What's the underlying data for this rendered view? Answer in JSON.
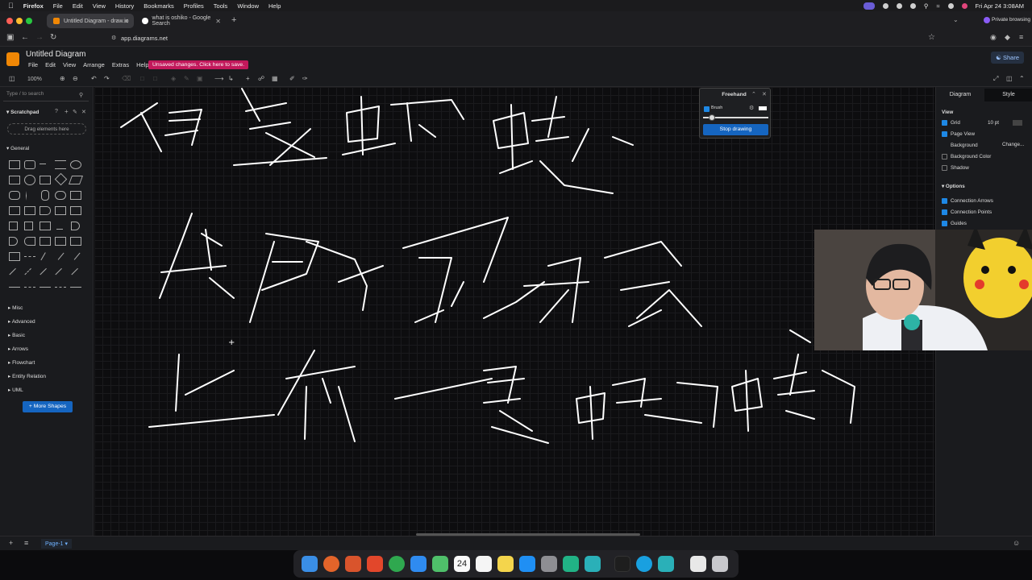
{
  "menubar": {
    "app": "Firefox",
    "items": [
      "File",
      "Edit",
      "View",
      "History",
      "Bookmarks",
      "Profiles",
      "Tools",
      "Window",
      "Help"
    ],
    "datetime": "Fri Apr 24  3:08AM",
    "status_icons": [
      "screen-record-icon",
      "play-icon",
      "moon-icon",
      "brightness-icon",
      "search-icon",
      "wifi-icon",
      "control-center-icon",
      "user-icon"
    ]
  },
  "browser": {
    "tabs": [
      {
        "title": "Untitled Diagram - draw.io",
        "active": true
      },
      {
        "title": "what is oshiko - Google Search",
        "active": false
      }
    ],
    "private_label": "Private browsing",
    "url": "app.diagrams.net"
  },
  "app": {
    "title": "Untitled Diagram",
    "menu": [
      "File",
      "Edit",
      "View",
      "Arrange",
      "Extras",
      "Help"
    ],
    "unsaved": "Unsaved changes. Click here to save.",
    "share": "Share",
    "zoom": "100%"
  },
  "sidebar": {
    "search_placeholder": "Type / to search",
    "scratchpad": "Scratchpad",
    "drag_here": "Drag elements here",
    "general": "General",
    "sections": [
      "Misc",
      "Advanced",
      "Basic",
      "Arrows",
      "Flowchart",
      "Entity Relation",
      "UML"
    ],
    "more_shapes": "+ More Shapes"
  },
  "freehand": {
    "title": "Freehand",
    "brush": "Brush",
    "brush_checked": true,
    "stop": "Stop drawing"
  },
  "format_panel": {
    "tabs": [
      "Diagram",
      "Style"
    ],
    "view_label": "View",
    "grid": {
      "label": "Grid",
      "checked": true,
      "value": "10 pt"
    },
    "page_view": {
      "label": "Page View",
      "checked": true
    },
    "background": {
      "label": "Background",
      "button": "Change..."
    },
    "background_color": {
      "label": "Background Color",
      "checked": false
    },
    "shadow": {
      "label": "Shadow",
      "checked": false
    },
    "options_label": "Options",
    "connection_arrows": {
      "label": "Connection Arrows",
      "checked": true
    },
    "connection_points": {
      "label": "Connection Points",
      "checked": true
    },
    "guides": {
      "label": "Guides",
      "checked": true
    }
  },
  "footer": {
    "page": "Page-1"
  },
  "dock": {
    "calendar_day": "24",
    "apps": [
      "finder-icon",
      "firefox-icon",
      "brave-like-icon",
      "brave-icon",
      "chrome-icon",
      "safari-icon",
      "maps-icon",
      "calendar-icon",
      "reminders-icon",
      "notes-icon",
      "app-store-icon",
      "settings-icon",
      "terminal-icon",
      "drawio-icon",
      "activity-icon",
      "browser-icon",
      "vscode-like-icon",
      "document-icon",
      "trash-icon"
    ]
  },
  "colors": {
    "accent": "#1565c0",
    "unsaved": "#c2185b",
    "drawio_orange": "#f08705",
    "ink": "#ffffff"
  }
}
